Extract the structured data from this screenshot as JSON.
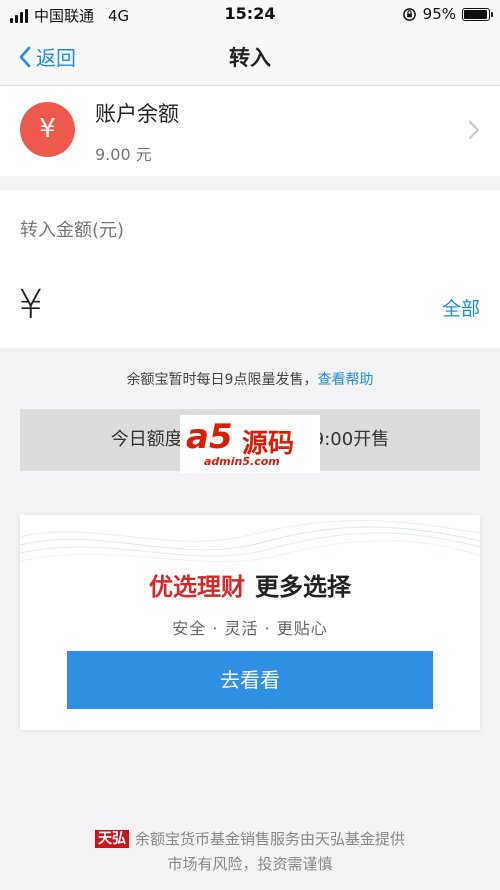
{
  "status_bar": {
    "carrier": "中国联通",
    "network": "4G",
    "time": "15:24",
    "battery_percent": "95%",
    "battery_level": 0.95
  },
  "nav": {
    "back_label": "返回",
    "title": "转入"
  },
  "account": {
    "icon_symbol": "¥",
    "label": "账户余额",
    "balance": "9.00 元",
    "icon_color": "#ed5a4d"
  },
  "transfer": {
    "label": "转入金额(元)",
    "currency_symbol": "¥",
    "amount_value": "",
    "all_label": "全部"
  },
  "notice": {
    "text": "余额宝暂时每日9点限量发售，",
    "help_link": "查看帮助"
  },
  "soldout_banner": {
    "text_left": "今日额度",
    "text_right": "9:00开售"
  },
  "watermark": {
    "brand": "a5",
    "brand_cn": "源码",
    "url": "admin5.com"
  },
  "promo": {
    "title_highlight": "优选理财",
    "title_rest": "更多选择",
    "subtitle": "安全 · 灵活 · 更贴心",
    "button_label": "去看看",
    "accent_color": "#2f8fe3"
  },
  "footer": {
    "logo_text": "天弘",
    "line1": "余额宝货币基金销售服务由天弘基金提供",
    "line2": "市场有风险，投资需谨慎"
  }
}
